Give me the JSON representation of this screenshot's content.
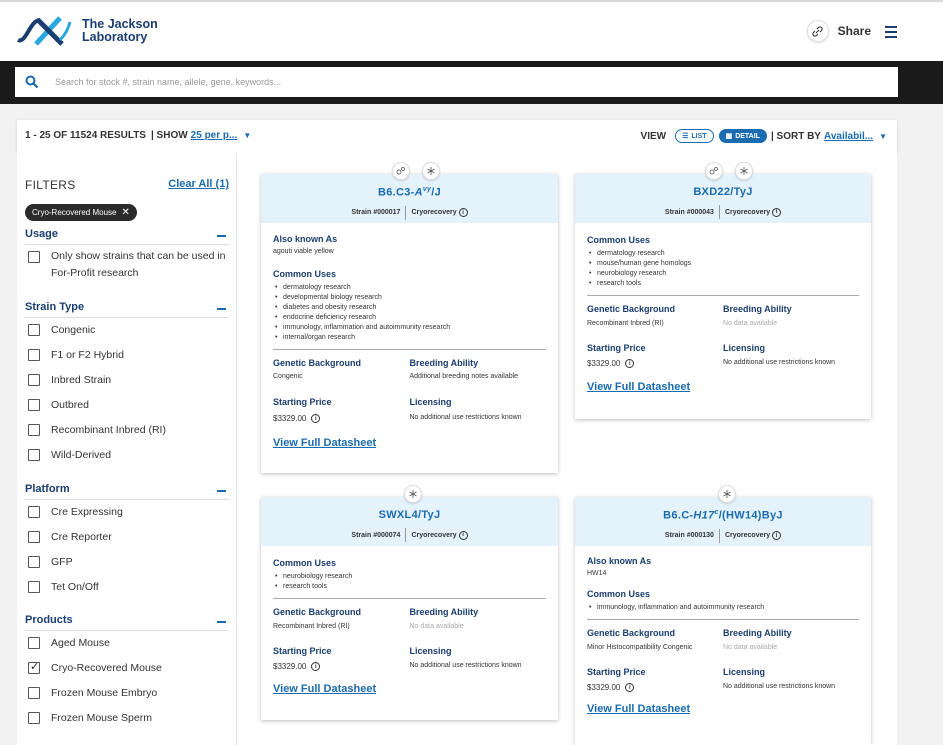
{
  "header": {
    "logo_name_line1": "The Jackson",
    "logo_name_line2": "Laboratory",
    "share_label": "Share"
  },
  "search": {
    "placeholder": "Search for stock #, strain name, allele, gene, keywords..."
  },
  "results": {
    "summary": "1 - 25 OF 11524 RESULTS",
    "show_label": "| SHOW",
    "per_page": "25 per p...",
    "view_label": "VIEW",
    "list_label": "LIST",
    "detail_label": "DETAIL",
    "sort_label": "| SORT BY",
    "sort_value": "Availabil..."
  },
  "filters": {
    "title": "FILTERS",
    "clear_all": "Clear All (1)",
    "active_chip": "Cryo-Recovered Mouse",
    "groups": [
      {
        "title": "Usage",
        "items": [
          {
            "label": "Only show strains that can be used in For-Profit research",
            "checked": false
          }
        ]
      },
      {
        "title": "Strain Type",
        "items": [
          {
            "label": "Congenic",
            "checked": false
          },
          {
            "label": "F1 or F2 Hybrid",
            "checked": false
          },
          {
            "label": "Inbred Strain",
            "checked": false
          },
          {
            "label": "Outbred",
            "checked": false
          },
          {
            "label": "Recombinant Inbred (RI)",
            "checked": false
          },
          {
            "label": "Wild-Derived",
            "checked": false
          }
        ]
      },
      {
        "title": "Platform",
        "items": [
          {
            "label": "Cre Expressing",
            "checked": false
          },
          {
            "label": "Cre Reporter",
            "checked": false
          },
          {
            "label": "GFP",
            "checked": false
          },
          {
            "label": "Tet On/Off",
            "checked": false
          }
        ]
      },
      {
        "title": "Products",
        "items": [
          {
            "label": "Aged Mouse",
            "checked": false
          },
          {
            "label": "Cryo-Recovered Mouse",
            "checked": true
          },
          {
            "label": "Frozen Mouse Embryo",
            "checked": false
          },
          {
            "label": "Frozen Mouse Sperm",
            "checked": false
          }
        ]
      }
    ]
  },
  "labels": {
    "aka": "Also known As",
    "common_uses": "Common Uses",
    "genetic_background": "Genetic Background",
    "breeding_ability": "Breeding Ability",
    "starting_price": "Starting Price",
    "licensing": "Licensing",
    "view_datasheet": "View Full Datasheet",
    "cryorecovery": "Cryorecovery"
  },
  "cards": [
    {
      "title_parts": [
        "B6.C3-",
        "A",
        "vy",
        "/J"
      ],
      "strain": "Strain #000017",
      "aka": "agouti viable yellow",
      "uses": [
        "dermatology research",
        "developmental biology research",
        "diabetes and obesity research",
        "endocrine deficiency research",
        "immunology, inflammation and autoimmunity research",
        "internal/organ research"
      ],
      "genetic_background": "Congenic",
      "breeding": "Additional breeding notes available",
      "price": "$3329.00",
      "licensing": "No additional use restrictions known"
    },
    {
      "title": "BXD22/TyJ",
      "strain": "Strain #000043",
      "uses": [
        "dermatology research",
        "mouse/human gene homologs",
        "neurobiology research",
        "research tools"
      ],
      "genetic_background": "Recombinant Inbred (RI)",
      "breeding": "No data available",
      "price": "$3329.00",
      "licensing": "No additional use restrictions known"
    },
    {
      "title": "SWXL4/TyJ",
      "strain": "Strain #000074",
      "uses": [
        "neurobiology research",
        "research tools"
      ],
      "genetic_background": "Recombinant Inbred (RI)",
      "breeding": "No data available",
      "price": "$3329.00",
      "licensing": "No additional use restrictions known"
    },
    {
      "title_parts": [
        "B6.C-",
        "H17",
        "c",
        "/(HW14)ByJ"
      ],
      "strain": "Strain #000130",
      "aka": "HW14",
      "uses": [
        "immunology, inflammation and autoimmunity research"
      ],
      "genetic_background": "Minor Histocompatibility Congenic",
      "breeding": "No data available",
      "price": "$3329.00",
      "licensing": "No additional use restrictions known"
    }
  ],
  "colors": {
    "brand_navy": "#1a3e6f",
    "link_blue": "#1b6bb0",
    "card_header": "#e3f2fb",
    "search_bar": "#1a1a1a"
  }
}
